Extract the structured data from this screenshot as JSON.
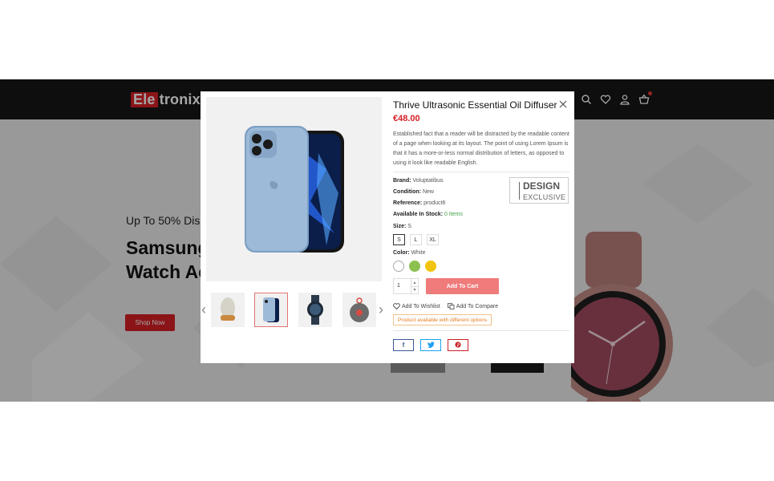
{
  "site": {
    "logo_part1": "Ele",
    "logo_part2": "tronix",
    "hero": {
      "subtitle": "Up To 50% Disc",
      "title_line1": "Samsung",
      "title_line2": "Watch Ac",
      "button_label": "Shop Now"
    },
    "header_icons": [
      "search-icon",
      "heart-icon",
      "user-icon",
      "cart-icon"
    ]
  },
  "modal": {
    "title": "Thrive Ultrasonic Essential Oil Diffuser",
    "price": "€48.00",
    "description": "Established fact that a reader will be distracted by the readable content of a page when looking at its layout. The point of using Lorem Ipsum is that it has a more-or-less normal distribution of letters, as opposed to using it look like readable English.",
    "brand_label": "Brand:",
    "brand_value": "Voluptatibus",
    "condition_label": "Condition:",
    "condition_value": "New",
    "reference_label": "Reference:",
    "reference_value": "product6",
    "stock_label": "Available In Stock:",
    "stock_value": "0 Items",
    "badge_line1": "DESIGN",
    "badge_line2": "EXCLUSIVE",
    "size_label": "Size:",
    "size_selected": "S",
    "sizes": [
      "S",
      "L",
      "XL"
    ],
    "color_label": "Color:",
    "color_selected": "White",
    "colors": [
      "#ffffff",
      "#8cc152",
      "#f1c40f"
    ],
    "quantity": "1",
    "add_to_cart": "Add To Cart",
    "wishlist": "Add To Wishlist",
    "compare": "Add To Compare",
    "availability_note": "Product available with different options",
    "thumbnails": [
      "diffuser-thumb",
      "iphone-thumb",
      "smartwatch-thumb",
      "speaker-thumb"
    ],
    "social": [
      "f",
      "t",
      "p"
    ],
    "colors_accent": {
      "price": "#d61f26",
      "add_to_cart": "#ef7b7b",
      "facebook": "#3b5998",
      "twitter": "#1da1f2",
      "pinterest": "#cb2027"
    }
  }
}
